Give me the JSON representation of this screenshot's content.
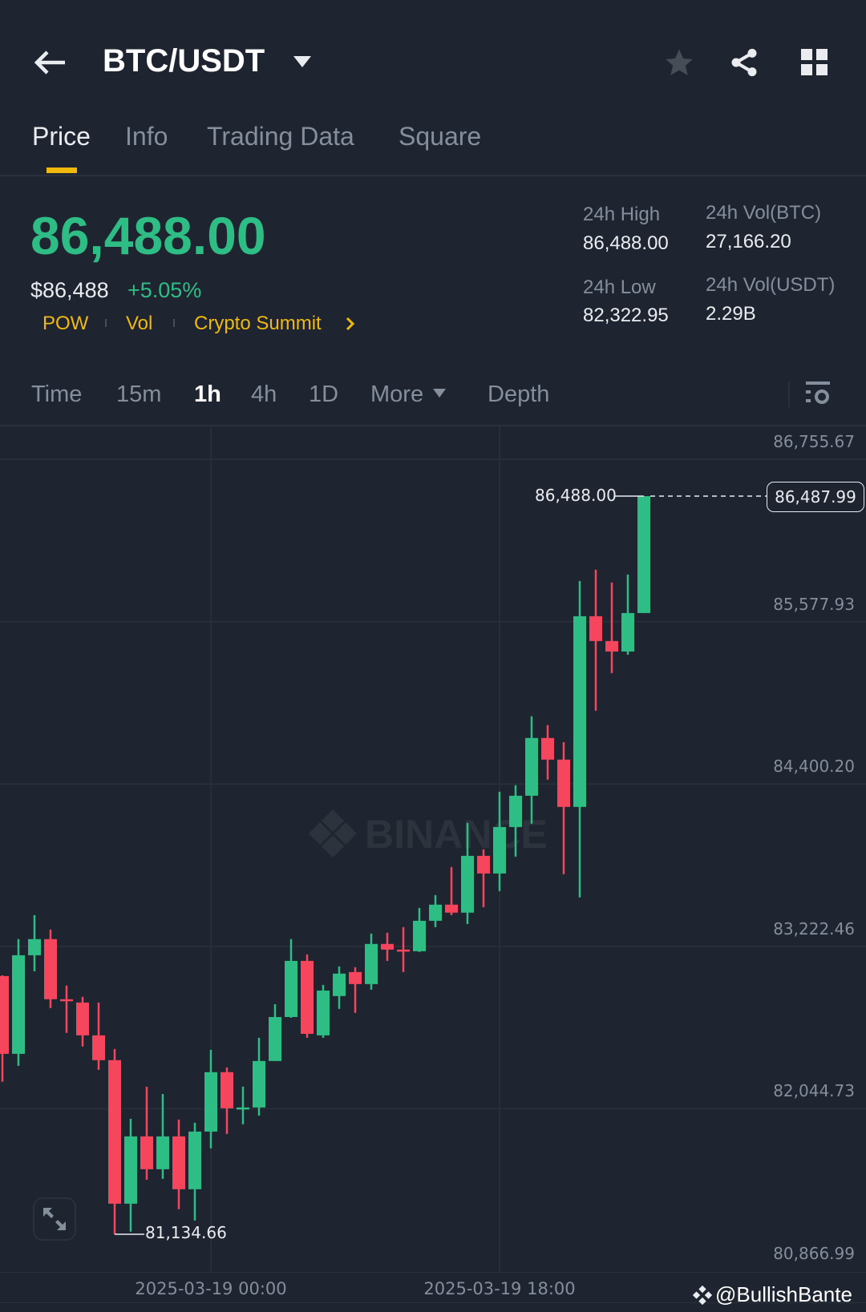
{
  "header": {
    "title": "BTC/USDT",
    "icons": [
      "back-arrow-icon",
      "caret-down-icon",
      "star-icon",
      "share-icon",
      "grid-icon"
    ]
  },
  "tabs": [
    {
      "label": "Price"
    },
    {
      "label": "Info"
    },
    {
      "label": "Trading Data"
    },
    {
      "label": "Square"
    }
  ],
  "ticker": {
    "last_price": "86,488.00",
    "usd_price": "$86,488",
    "change": "+5.05%",
    "tags": [
      "POW",
      "Vol",
      "Crypto Summit"
    ],
    "stats": {
      "high_label": "24h High",
      "high": "86,488.00",
      "low_label": "24h Low",
      "low": "82,322.95",
      "vol_btc_label": "24h Vol(BTC)",
      "vol_btc": "27,166.20",
      "vol_usdt_label": "24h Vol(USDT)",
      "vol_usdt": "2.29B"
    }
  },
  "intervals": [
    {
      "label": "Time"
    },
    {
      "label": "15m"
    },
    {
      "label": "1h"
    },
    {
      "label": "4h"
    },
    {
      "label": "1D"
    },
    {
      "label": "More"
    },
    {
      "label": "Depth"
    }
  ],
  "colors": {
    "up": "#2EBD85",
    "down": "#F6465D",
    "accent": "#F0B90B",
    "bg": "#1F2530"
  },
  "chart_data": {
    "type": "candlestick",
    "interval": "1h",
    "y_ticks": [
      "86,755.67",
      "85,577.93",
      "84,400.20",
      "83,222.46",
      "82,044.73",
      "80,866.99"
    ],
    "ylim": [
      80866.99,
      86755.67
    ],
    "x_ticks": [
      {
        "label": "2025-03-19 00:00",
        "index": 13
      },
      {
        "label": "2025-03-19 18:00",
        "index": 31
      }
    ],
    "last_price_label": "86,487.99",
    "high_marker": "86,488.00",
    "low_marker": "81,134.66",
    "watermark": "BINANCE",
    "candles": [
      [
        83007,
        83013,
        82240,
        82443
      ],
      [
        82443,
        83275,
        82356,
        83158
      ],
      [
        83158,
        83449,
        83042,
        83275
      ],
      [
        83275,
        83344,
        82775,
        82839
      ],
      [
        82839,
        82938,
        82595,
        82827
      ],
      [
        82815,
        82856,
        82496,
        82577
      ],
      [
        82577,
        82815,
        82327,
        82397
      ],
      [
        82397,
        82478,
        81134.66,
        81356
      ],
      [
        81356,
        81972,
        81153,
        81844
      ],
      [
        81844,
        82205,
        81530,
        81606
      ],
      [
        81606,
        82152,
        81536,
        81844
      ],
      [
        81844,
        81966,
        81316,
        81461
      ],
      [
        81461,
        81943,
        81234,
        81879
      ],
      [
        81879,
        82472,
        81757,
        82310
      ],
      [
        82310,
        82344,
        81862,
        82048
      ],
      [
        82048,
        82205,
        81932,
        82054
      ],
      [
        82054,
        82559,
        81995,
        82391
      ],
      [
        82391,
        82803,
        82391,
        82710
      ],
      [
        82710,
        83275,
        82705,
        83117
      ],
      [
        83117,
        83164,
        82559,
        82588
      ],
      [
        82577,
        82943,
        82559,
        82902
      ],
      [
        82862,
        83077,
        82769,
        83025
      ],
      [
        83036,
        83071,
        82740,
        82949
      ],
      [
        82949,
        83315,
        82908,
        83240
      ],
      [
        83240,
        83321,
        83117,
        83199
      ],
      [
        83199,
        83362,
        83036,
        83187
      ],
      [
        83187,
        83501,
        83182,
        83408
      ],
      [
        83408,
        83594,
        83362,
        83525
      ],
      [
        83525,
        83798,
        83449,
        83467
      ],
      [
        83467,
        84118,
        83385,
        83879
      ],
      [
        83879,
        83926,
        83507,
        83751
      ],
      [
        83751,
        84344,
        83623,
        84088
      ],
      [
        84088,
        84391,
        83873,
        84315
      ],
      [
        84315,
        84891,
        84112,
        84734
      ],
      [
        84734,
        84827,
        84432,
        84577
      ],
      [
        84577,
        84704,
        83746,
        84234
      ],
      [
        84234,
        85873,
        83577,
        85617
      ],
      [
        85617,
        85954,
        84931,
        85437
      ],
      [
        85437,
        85861,
        85204,
        85361
      ],
      [
        85361,
        85919,
        85338,
        85640
      ],
      [
        85640,
        86488,
        85640,
        86488
      ]
    ],
    "candle_format": [
      "open",
      "high",
      "low",
      "close"
    ]
  },
  "footer": {
    "watermark": "@BullishBante"
  }
}
